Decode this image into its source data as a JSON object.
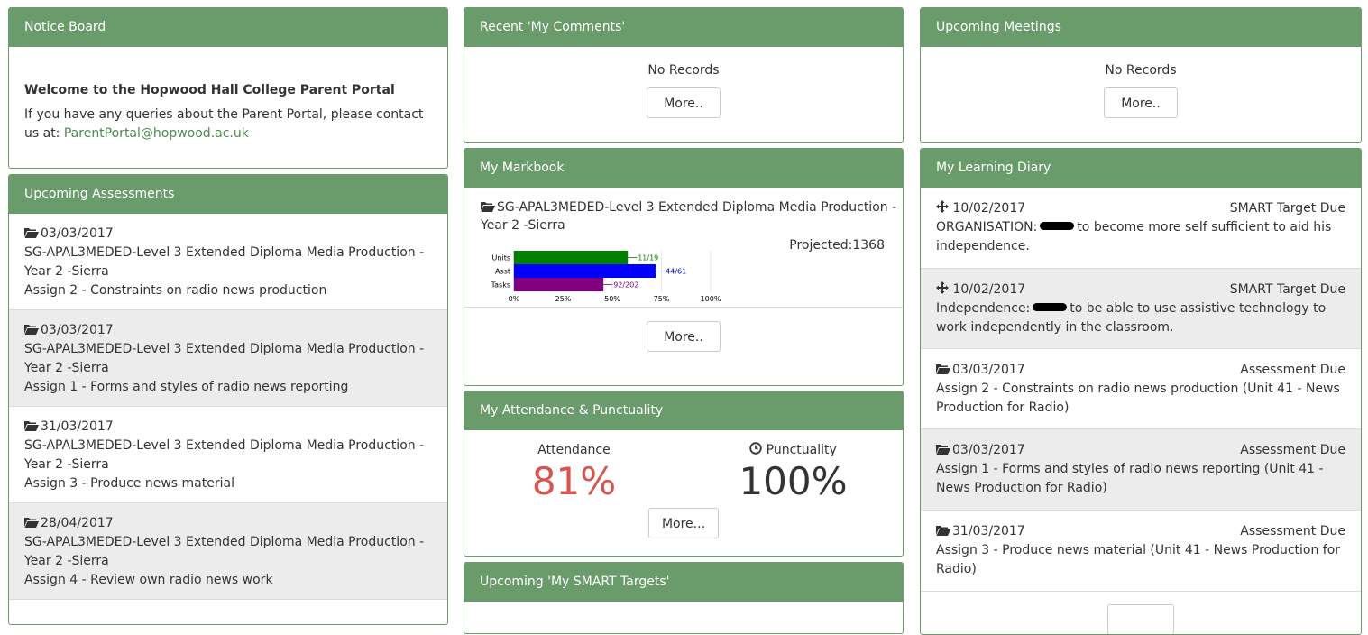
{
  "notice": {
    "title": "Notice Board",
    "heading": "Welcome to the Hopwood Hall College Parent Portal",
    "text": "If you have any queries about the Parent Portal, please contact us at:",
    "email": "ParentPortal@hopwood.ac.uk"
  },
  "assessments": {
    "title": "Upcoming Assessments",
    "items": [
      {
        "date": "03/03/2017",
        "course": "SG-APAL3MEDED-Level 3 Extended Diploma Media Production - Year 2 -Sierra",
        "task": "Assign 2 - Constraints on radio news production"
      },
      {
        "date": "03/03/2017",
        "course": "SG-APAL3MEDED-Level 3 Extended Diploma Media Production - Year 2 -Sierra",
        "task": "Assign 1 - Forms and styles of radio news reporting"
      },
      {
        "date": "31/03/2017",
        "course": "SG-APAL3MEDED-Level 3 Extended Diploma Media Production - Year 2 -Sierra",
        "task": "Assign 3 - Produce news material"
      },
      {
        "date": "28/04/2017",
        "course": "SG-APAL3MEDED-Level 3 Extended Diploma Media Production - Year 2 -Sierra",
        "task": "Assign 4 - Review own radio news work"
      }
    ]
  },
  "comments": {
    "title": "Recent 'My Comments'",
    "empty": "No Records",
    "more": "More.."
  },
  "markbook": {
    "title": "My Markbook",
    "course": "SG-APAL3MEDED-Level 3 Extended Diploma Media Production - Year 2 -Sierra",
    "projected": "Projected:1368",
    "more": "More.."
  },
  "chart_data": {
    "type": "bar",
    "orientation": "horizontal",
    "categories": [
      "Units",
      "Asst",
      "Tasks"
    ],
    "values": [
      57.9,
      72.1,
      45.5
    ],
    "labels": [
      "11/19",
      "44/61",
      "92/202"
    ],
    "colors": [
      "#008000",
      "#0000ff",
      "#800080"
    ],
    "label_colors": [
      "#008000",
      "#0000cc",
      "#800080"
    ],
    "xticks": [
      "0%",
      "25%",
      "50%",
      "75%",
      "100%"
    ],
    "xlim": [
      0,
      100
    ]
  },
  "attendance": {
    "title": "My Attendance & Punctuality",
    "attendance_label": "Attendance",
    "attendance_value": "81%",
    "punctuality_label": "Punctuality",
    "punctuality_value": "100%",
    "more": "More...",
    "colors": {
      "attendance": "#d9534f",
      "punctuality": "#333333"
    }
  },
  "smart": {
    "title": "Upcoming 'My SMART Targets'"
  },
  "meetings": {
    "title": "Upcoming Meetings",
    "empty": "No Records",
    "more": "More.."
  },
  "diary": {
    "title": "My Learning Diary",
    "items": [
      {
        "icon": "move-icon",
        "date": "10/02/2017",
        "type": "SMART Target Due",
        "pre": "ORGANISATION:",
        "post": "to become more self sufficient to aid his independence.",
        "redacted": true
      },
      {
        "icon": "move-icon",
        "date": "10/02/2017",
        "type": "SMART Target Due",
        "pre": "Independence:",
        "post": "to be able to use assistive technology to work independently in the classroom.",
        "redacted": true
      },
      {
        "icon": "folder-icon",
        "date": "03/03/2017",
        "type": "Assessment Due",
        "text": "Assign 2 - Constraints on radio news production (Unit 41 - News Production for Radio)"
      },
      {
        "icon": "folder-icon",
        "date": "03/03/2017",
        "type": "Assessment Due",
        "text": "Assign 1 - Forms and styles of radio news reporting (Unit 41 - News Production for Radio)"
      },
      {
        "icon": "folder-icon",
        "date": "31/03/2017",
        "type": "Assessment Due",
        "text": "Assign 3 - Produce news material (Unit 41 - News Production for Radio)"
      }
    ]
  },
  "theme": {
    "accent": "#6a9b6a",
    "link": "#4e8a4e",
    "alt_row": "#ececec"
  }
}
